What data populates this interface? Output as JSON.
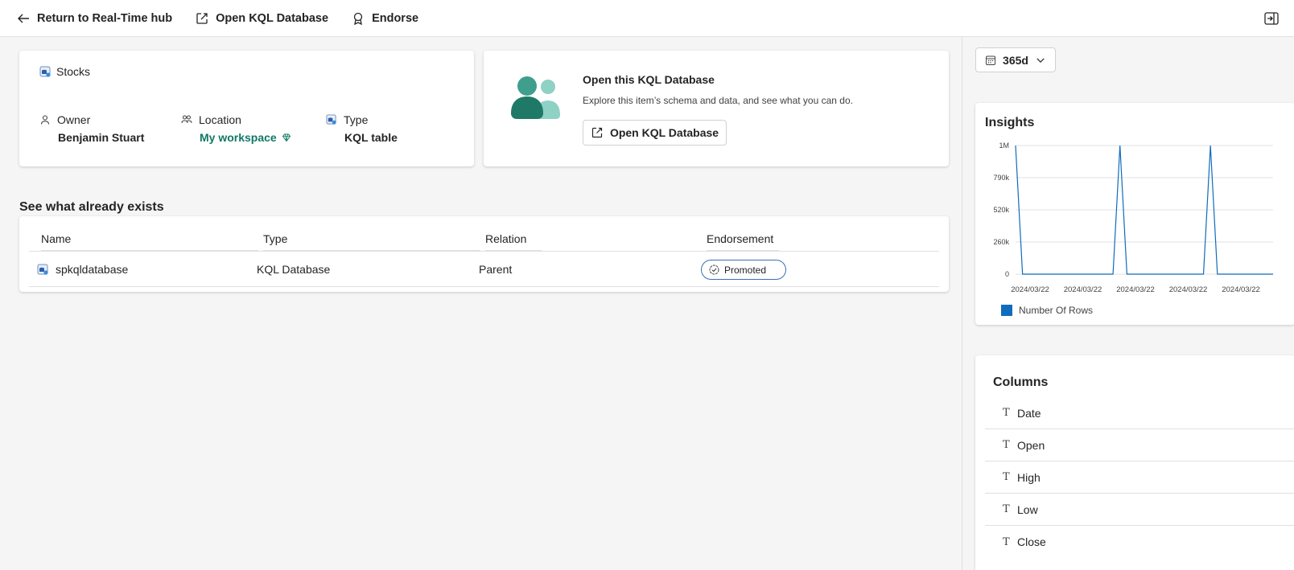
{
  "toolbar": {
    "return_label": "Return to Real-Time hub",
    "open_label": "Open KQL Database",
    "endorse_label": "Endorse"
  },
  "item": {
    "name": "Stocks",
    "owner_label": "Owner",
    "owner_value": "Benjamin Stuart",
    "location_label": "Location",
    "location_value": "My workspace",
    "type_label": "Type",
    "type_value": "KQL table"
  },
  "open_card": {
    "title": "Open this KQL Database",
    "description": "Explore this item’s schema and data, and see what you can do.",
    "button_label": "Open KQL Database"
  },
  "related": {
    "section_title": "See what already exists",
    "columns": [
      "Name",
      "Type",
      "Relation",
      "Endorsement"
    ],
    "rows": [
      {
        "name": "spkqldatabase",
        "type": "KQL Database",
        "relation": "Parent",
        "endorsement": "Promoted"
      }
    ]
  },
  "side": {
    "range_label": "365d",
    "insights_title": "Insights",
    "columns_title": "Columns",
    "columns": [
      "Date",
      "Open",
      "High",
      "Low",
      "Close"
    ]
  },
  "colors": {
    "accent_green": "#117865",
    "chart_line": "#0f6cbd",
    "badge_border": "#3a6fb7"
  },
  "chart_data": {
    "type": "line",
    "title": "",
    "xlabel": "",
    "ylabel": "",
    "y_ticks": [
      "0",
      "260k",
      "520k",
      "790k",
      "1M"
    ],
    "ylim": [
      0,
      1050000
    ],
    "x_ticks": [
      "2024/03/22",
      "2024/03/22",
      "2024/03/22",
      "2024/03/22",
      "2024/03/22"
    ],
    "series": [
      {
        "name": "Number Of Rows",
        "values": [
          1050000,
          0,
          0,
          0,
          0,
          0,
          0,
          0,
          0,
          0,
          0,
          0,
          0,
          0,
          0,
          1050000,
          0,
          0,
          0,
          0,
          0,
          0,
          0,
          0,
          0,
          0,
          0,
          0,
          1050000,
          0,
          0,
          0,
          0,
          0,
          0,
          0,
          0,
          0
        ]
      }
    ]
  }
}
